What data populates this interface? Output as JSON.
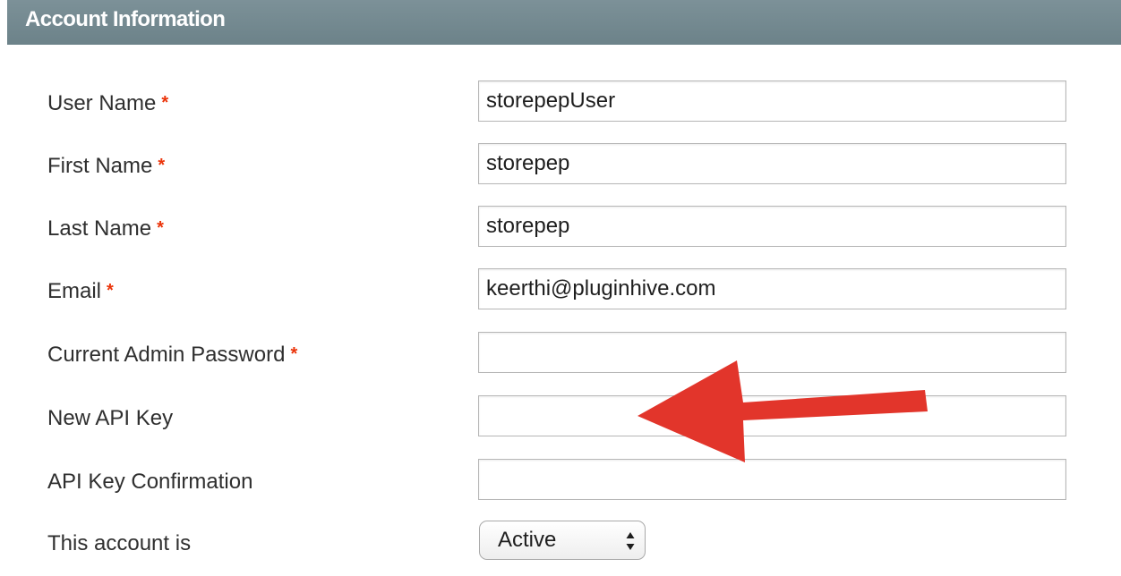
{
  "section": {
    "title": "Account Information"
  },
  "form": {
    "required_marker": "*",
    "fields": [
      {
        "label": "User Name",
        "value": "storepepUser",
        "required": true
      },
      {
        "label": "First Name",
        "value": "storepep",
        "required": true
      },
      {
        "label": "Last Name",
        "value": "storepep",
        "required": true
      },
      {
        "label": "Email",
        "value": "keerthi@pluginhive.com",
        "required": true
      },
      {
        "label": "Current Admin Password",
        "value": "",
        "required": true
      },
      {
        "label": "New API Key",
        "value": "",
        "required": false
      },
      {
        "label": "API Key Confirmation",
        "value": "",
        "required": false
      }
    ],
    "status": {
      "label": "This account is",
      "selected": "Active"
    }
  },
  "annotation": {
    "arrow_color": "#e2352b",
    "icon": "red-arrow-icon"
  },
  "colors": {
    "header_bg": "#748990",
    "required": "#eb340a"
  }
}
